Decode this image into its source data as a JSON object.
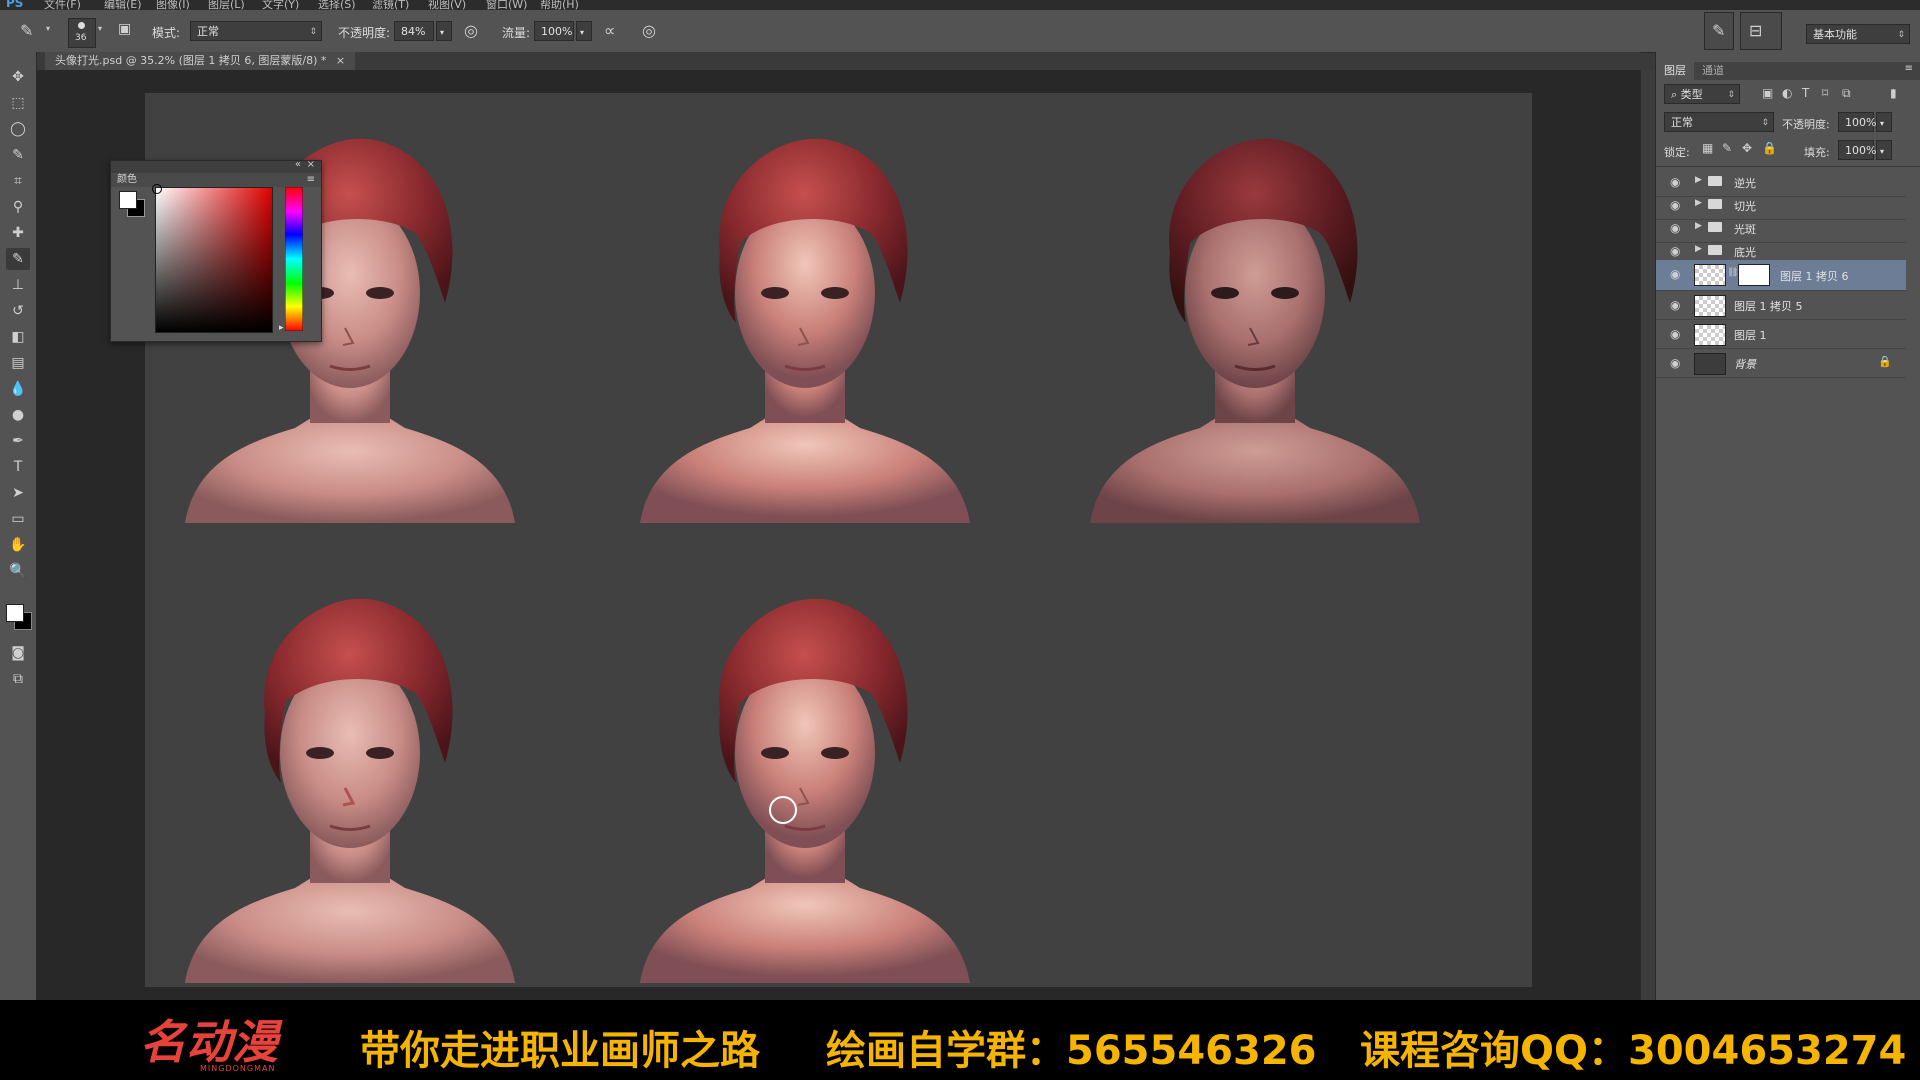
{
  "menubar": {
    "app_logo": "PS",
    "items": [
      "文件(F)",
      "编辑(E)",
      "图像(I)",
      "图层(L)",
      "文字(Y)",
      "选择(S)",
      "滤镜(T)",
      "视图(V)",
      "窗口(W)",
      "帮助(H)"
    ]
  },
  "options": {
    "brush_size": "36",
    "mode_label": "模式:",
    "mode_value": "正常",
    "opacity_label": "不透明度:",
    "opacity_value": "84%",
    "flow_label": "流量:",
    "flow_value": "100%",
    "workspace_value": "基本功能"
  },
  "document": {
    "tab_title": "头像打光.psd @ 35.2% (图层 1 拷贝 6, 图层蒙版/8) *",
    "close_glyph": "×"
  },
  "color_panel": {
    "title": "颜色",
    "hue_color": "#e00000"
  },
  "layers_panel": {
    "tabs": [
      "图层",
      "通道"
    ],
    "filter_value": "类型",
    "blend_value": "正常",
    "opacity_label": "不透明度:",
    "opacity_value": "100%",
    "lock_label": "锁定:",
    "fill_label": "填充:",
    "fill_value": "100%",
    "layers": [
      {
        "name": "逆光",
        "kind": "group"
      },
      {
        "name": "切光",
        "kind": "group"
      },
      {
        "name": "光斑",
        "kind": "group"
      },
      {
        "name": "底光",
        "kind": "group"
      },
      {
        "name": "图层 1 拷贝 6",
        "kind": "masked",
        "selected": true
      },
      {
        "name": "图层 1 拷贝 5",
        "kind": "layer"
      },
      {
        "name": "图层 1",
        "kind": "layer"
      },
      {
        "name": "背景",
        "kind": "background"
      }
    ]
  },
  "banner": {
    "logo_text": "名动漫",
    "logo_sub": "MINGDONGMAN",
    "slogan": "带你走进职业画师之路",
    "group": "绘画自学群：565546326",
    "qq": "课程咨询QQ：3004653274"
  }
}
